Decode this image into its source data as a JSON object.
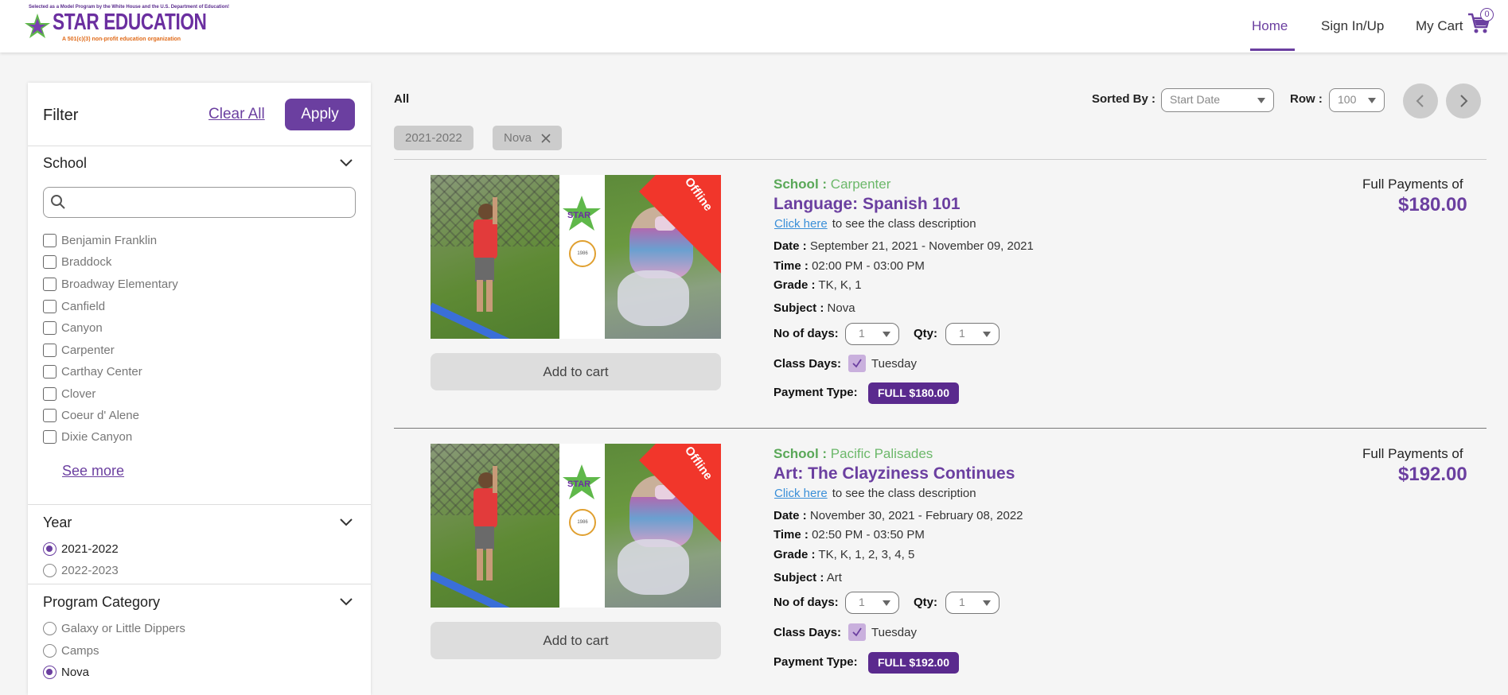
{
  "header": {
    "logo_tagline": "Selected as a Model Program by the White House and the U.S. Department of Education!",
    "logo_name": "STAR EDUCATION",
    "logo_sub": "A 501(c)(3) non-profit education organization",
    "nav_home": "Home",
    "nav_sign": "Sign In/Up",
    "nav_cart": "My Cart",
    "cart_count": "0",
    "accent_color": "#6b3fa0"
  },
  "filter": {
    "title": "Filter",
    "clear_all": "Clear All",
    "apply": "Apply",
    "school": {
      "title": "School",
      "search_placeholder": "",
      "items": [
        "Benjamin Franklin",
        "Braddock",
        "Broadway Elementary",
        "Canfield",
        "Canyon",
        "Carpenter",
        "Carthay Center",
        "Clover",
        "Coeur d' Alene",
        "Dixie Canyon"
      ],
      "see_more": "See more"
    },
    "year": {
      "title": "Year",
      "options": [
        "2021-2022",
        "2022-2023"
      ],
      "selected": "2021-2022"
    },
    "program_category": {
      "title": "Program Category",
      "options": [
        "Galaxy or Little Dippers",
        "Camps",
        "Nova"
      ],
      "selected": "Nova"
    }
  },
  "toolbar": {
    "all_label": "All",
    "sorted_by_label": "Sorted By :",
    "sorted_by_value": "Start Date",
    "row_label": "Row :",
    "row_value": "100",
    "chips": [
      "2021-2022",
      "Nova"
    ]
  },
  "courses": [
    {
      "school_label": "School :",
      "school": "Carpenter",
      "title": "Language: Spanish 101",
      "click_here": "Click here",
      "desc_suffix": "to see the class description",
      "date_label": "Date :",
      "date": "September 21, 2021 - November 09, 2021",
      "time_label": "Time :",
      "time": "02:00 PM - 03:00 PM",
      "grade_label": "Grade :",
      "grade": "TK, K, 1",
      "subject_label": "Subject :",
      "subject": "Nova",
      "days_label": "No of days:",
      "days_value": "1",
      "qty_label": "Qty:",
      "qty_value": "1",
      "class_days_label": "Class Days:",
      "class_day": "Tuesday",
      "payment_label": "Payment Type:",
      "payment_badge": "FULL   $180.00",
      "price_label": "Full Payments of",
      "price": "$180.00",
      "image_badge": "Offline",
      "add_to_cart": "Add to cart"
    },
    {
      "school_label": "School :",
      "school": "Pacific Palisades",
      "title": "Art: The Clayziness Continues",
      "click_here": "Click here",
      "desc_suffix": "to see the class description",
      "date_label": "Date :",
      "date": "November 30, 2021 - February 08, 2022",
      "time_label": "Time :",
      "time": "02:50 PM - 03:50 PM",
      "grade_label": "Grade :",
      "grade": "TK, K, 1, 2, 3, 4, 5",
      "subject_label": "Subject :",
      "subject": "Art",
      "days_label": "No of days:",
      "days_value": "1",
      "qty_label": "Qty:",
      "qty_value": "1",
      "class_days_label": "Class Days:",
      "class_day": "Tuesday",
      "payment_label": "Payment Type:",
      "payment_badge": "FULL   $192.00",
      "price_label": "Full Payments of",
      "price": "$192.00",
      "image_badge": "Offline",
      "add_to_cart": "Add to cart"
    }
  ]
}
